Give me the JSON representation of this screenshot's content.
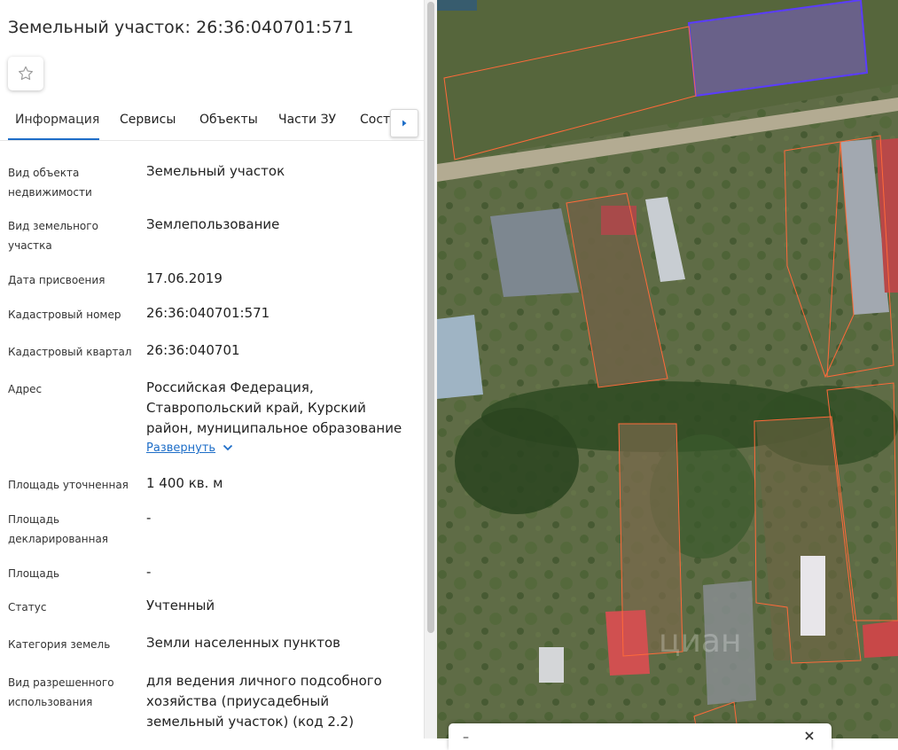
{
  "parcel": {
    "title": "Земельный участок: 26:36:040701:571"
  },
  "tabs": [
    {
      "label": "Информация",
      "active": true
    },
    {
      "label": "Сервисы"
    },
    {
      "label": "Объекты"
    },
    {
      "label": "Части ЗУ"
    },
    {
      "label": "Соста"
    }
  ],
  "info": [
    {
      "label": "Вид объекта недвижимости",
      "value": "Земельный участок"
    },
    {
      "label": "Вид земельного участка",
      "value": "Землепользование"
    },
    {
      "label": "Дата присвоения",
      "value": "17.06.2019"
    },
    {
      "label": "Кадастровый номер",
      "value": "26:36:040701:571"
    },
    {
      "label": "Кадастровый квартал",
      "value": "26:36:040701"
    },
    {
      "label": "Адрес",
      "value": "Российская Федерация, Ставропольский край, Курский район, муниципальное образование"
    },
    {
      "label": "Площадь уточненная",
      "value": "1 400 кв. м"
    },
    {
      "label": "Площадь декларированная",
      "value": "-"
    },
    {
      "label": "Площадь",
      "value": "-"
    },
    {
      "label": "Статус",
      "value": "Учтенный"
    },
    {
      "label": "Категория земель",
      "value": "Земли населенных пунктов"
    },
    {
      "label": "Вид разрешенного использования",
      "value": "для ведения личного подсобного хозяйства (приусадебный земельный участок) (код 2.2)"
    }
  ],
  "address_expand": "Развернуть",
  "map": {
    "bottom_card_left": "–",
    "colors": {
      "boundary": "#ff6a3a",
      "highlight_stroke": "#5a3cff",
      "highlight_fill": "#7a5cc8"
    }
  },
  "icons": {
    "favorite": "star-outline-icon",
    "tabs_next": "chevron-right-icon",
    "expand": "chevron-down-icon"
  }
}
